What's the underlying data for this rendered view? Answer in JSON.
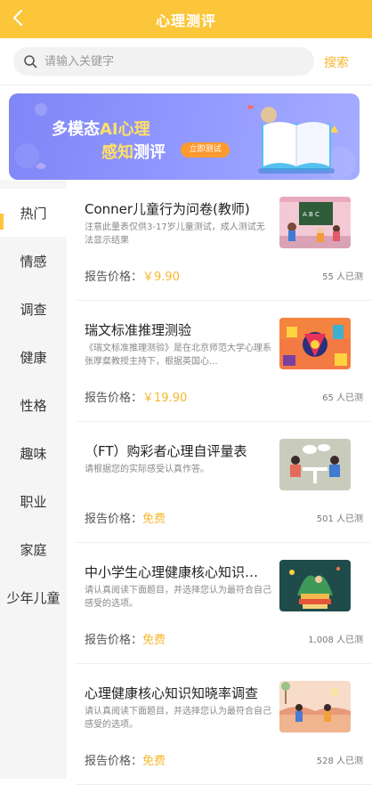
{
  "header": {
    "title": "心理测评"
  },
  "search": {
    "placeholder": "请输入关键字",
    "button_label": "搜索"
  },
  "banner": {
    "line1_prefix": "多模态",
    "line1_highlight": "AI心理",
    "line2_highlight": "感知",
    "line2_suffix": "测评",
    "button_label": "立即测试"
  },
  "sidebar": {
    "items": [
      {
        "label": "热门",
        "active": true
      },
      {
        "label": "情感"
      },
      {
        "label": "调查"
      },
      {
        "label": "健康"
      },
      {
        "label": "性格"
      },
      {
        "label": "趣味"
      },
      {
        "label": "职业"
      },
      {
        "label": "家庭"
      },
      {
        "label": "少年儿童"
      }
    ]
  },
  "price_label": "报告价格：",
  "cards": [
    {
      "title": "Conner儿童行为问卷(教师)",
      "desc": "注意此量表仅供3-17岁儿童测试，成人测试无法显示结果",
      "price": "￥9.90",
      "count": "55 人已测",
      "thumb": "classroom-illustration"
    },
    {
      "title": "瑞文标准推理测验",
      "desc": "《瑞文标准推理测验》是在北京师范大学心理系张厚粲教授主持下，根据英国心...",
      "price": "￥19.90",
      "count": "65 人已测",
      "thumb": "puzzle-illustration"
    },
    {
      "title": "（FT）购彩者心理自评量表",
      "desc": "请根据您的实际感受认真作答。",
      "price": "免费",
      "count": "501 人已测",
      "thumb": "meeting-illustration"
    },
    {
      "title": "中小学生心理健康核心知识知晓率调查",
      "desc": "请认真阅读下面题目，并选择您认为最符合自己感受的选项。",
      "price": "免费",
      "count": "1,008 人已测",
      "thumb": "reading-illustration"
    },
    {
      "title": "心理健康核心知识知晓率调查",
      "desc": "请认真阅读下面题目，并选择您认为最符合自己感受的选项。",
      "price": "免费",
      "count": "528 人已测",
      "thumb": "outdoor-illustration"
    }
  ],
  "colors": {
    "accent": "#FCC63A",
    "price": "#F7B72E",
    "banner": "#8f96ff"
  }
}
